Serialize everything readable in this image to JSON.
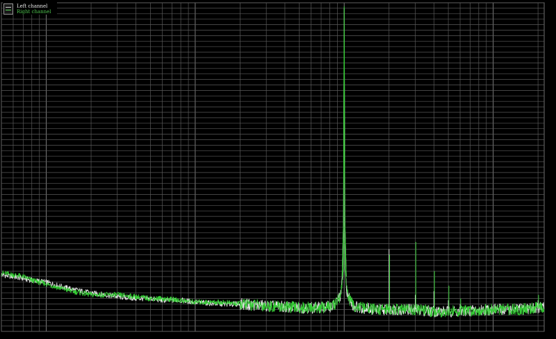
{
  "legend": {
    "items": [
      {
        "label": "Left channel",
        "color": "#e6e6e6"
      },
      {
        "label": "Right channel",
        "color": "#33cc33"
      }
    ]
  },
  "colors": {
    "background": "#000000",
    "grid": "#5a5a5a",
    "left_channel": "#e6e6e6",
    "right_channel": "#33cc33"
  },
  "chart_data": {
    "type": "line",
    "xscale": "log",
    "xlim": [
      5,
      22000
    ],
    "ylim": [
      -180,
      0
    ],
    "grid": true,
    "legend_position": "top-left",
    "fundamental_hz": 1000,
    "series": [
      {
        "name": "Left channel",
        "color": "#e6e6e6",
        "x": [
          5,
          6,
          7,
          8,
          10,
          12,
          15,
          20,
          25,
          30,
          40,
          50,
          60,
          80,
          100,
          150,
          200,
          300,
          500,
          700,
          850,
          950,
          990,
          1000,
          1010,
          1050,
          1150,
          1300,
          1600,
          2000,
          3000,
          4000,
          6000,
          10000,
          15000,
          20000
        ],
        "y": [
          -149,
          -150,
          -151,
          -152,
          -153,
          -155,
          -157,
          -159,
          -160,
          -161,
          -162,
          -162,
          -163,
          -163,
          -164,
          -165,
          -165,
          -166,
          -167,
          -167,
          -166,
          -160,
          -145,
          -3,
          -145,
          -160,
          -166,
          -167,
          -168,
          -168,
          -168,
          -169,
          -169,
          -168,
          -168,
          -167
        ]
      },
      {
        "name": "Right channel",
        "color": "#33cc33",
        "x": [
          5,
          6,
          7,
          8,
          10,
          12,
          15,
          20,
          25,
          30,
          40,
          50,
          60,
          80,
          100,
          150,
          200,
          300,
          500,
          700,
          850,
          950,
          990,
          1000,
          1010,
          1050,
          1150,
          1300,
          1600,
          2000,
          3000,
          4000,
          6000,
          10000,
          15000,
          20000
        ],
        "y": [
          -148,
          -149,
          -150,
          -152,
          -154,
          -156,
          -158,
          -160,
          -160,
          -160,
          -161,
          -162,
          -162,
          -163,
          -164,
          -164,
          -165,
          -166,
          -167,
          -167,
          -166,
          -160,
          -144,
          -2,
          -144,
          -160,
          -166,
          -167,
          -168,
          -168,
          -168,
          -169,
          -169,
          -168,
          -168,
          -167
        ]
      }
    ],
    "harmonics": [
      {
        "x": 2000,
        "left": -135,
        "right": -138
      },
      {
        "x": 3000,
        "left": -160,
        "right": -131
      },
      {
        "x": 4000,
        "left": -158,
        "right": -147
      },
      {
        "x": 5000,
        "left": -163,
        "right": -155
      },
      {
        "x": 6000,
        "left": -165,
        "right": -162
      },
      {
        "x": 20000,
        "left": -163,
        "right": -160
      }
    ]
  }
}
